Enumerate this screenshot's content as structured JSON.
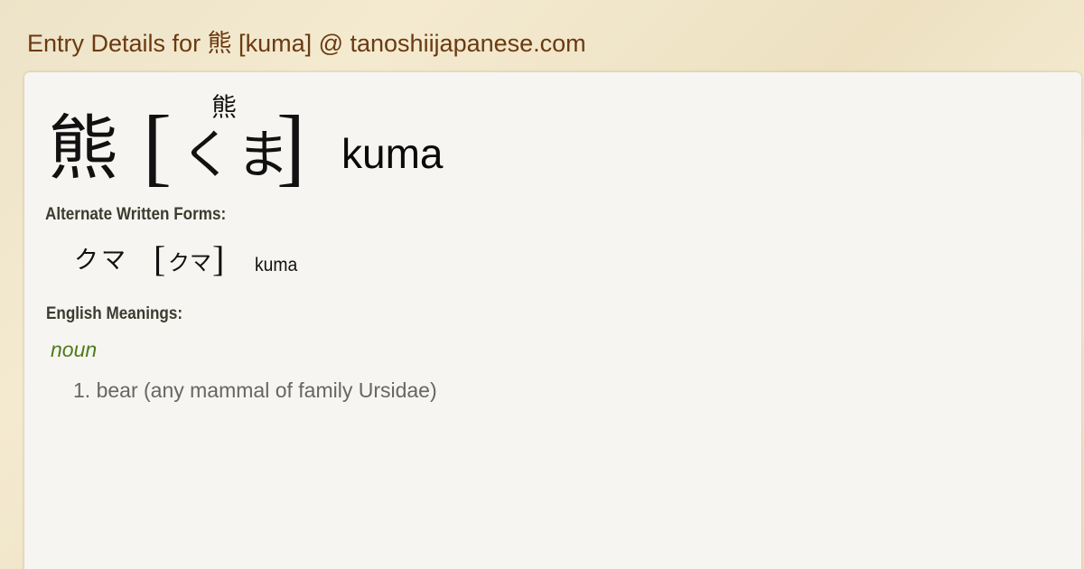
{
  "page": {
    "title": "Entry Details for 熊 [kuma] @ tanoshiijapanese.com"
  },
  "entry": {
    "headword": "熊",
    "bracket_open": "[",
    "furigana": "熊",
    "kana": "くま",
    "bracket_close": "]",
    "romaji": "kuma"
  },
  "alternate_forms": {
    "label": "Alternate Written Forms:",
    "items": [
      {
        "written": "クマ",
        "bracket_open": "[",
        "reading": "クマ",
        "bracket_close": "]",
        "romaji": "kuma"
      }
    ]
  },
  "meanings": {
    "label": "English Meanings:",
    "part_of_speech": "noun",
    "definitions": [
      "1. bear (any mammal of family Ursidae)"
    ]
  },
  "colors": {
    "title": "#6b3a10",
    "part_of_speech": "#4f7a1c",
    "definition": "#666666",
    "card_background": "#f6f5f1"
  }
}
